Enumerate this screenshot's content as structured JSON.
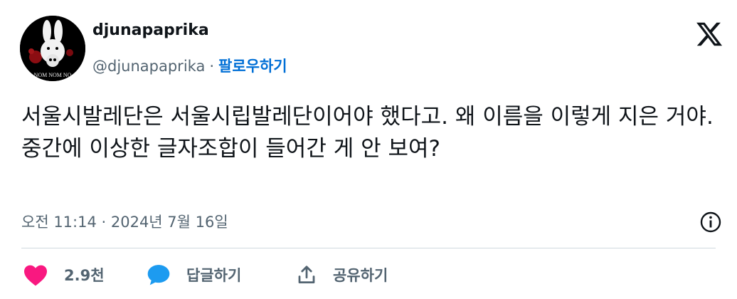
{
  "author": {
    "display_name": "djunapaprika",
    "handle": "@djunapaprika",
    "separator": "·",
    "follow_label": "팔로우하기",
    "avatar_text": "NOM NOM NO"
  },
  "tweet": {
    "text": "서울시발레단은 서울시립발레단이어야 했다고. 왜 이름을 이렇게 지은 거야. 중간에 이상한 글자조합이 들어간 게 안 보여?",
    "timestamp": "오전 11:14 · 2024년 7월 16일"
  },
  "actions": {
    "like_count": "2.9천",
    "reply_label": "답글하기",
    "share_label": "공유하기"
  },
  "icons": {
    "platform": "x-logo-icon",
    "info": "info-icon",
    "like": "heart-icon",
    "reply": "speech-bubble-icon",
    "share": "share-icon"
  },
  "colors": {
    "text": "#0f1419",
    "secondary": "#536471",
    "link": "#006fd6",
    "like": "#f91880",
    "reply": "#1d9bf0",
    "divider": "#cfd9de"
  }
}
